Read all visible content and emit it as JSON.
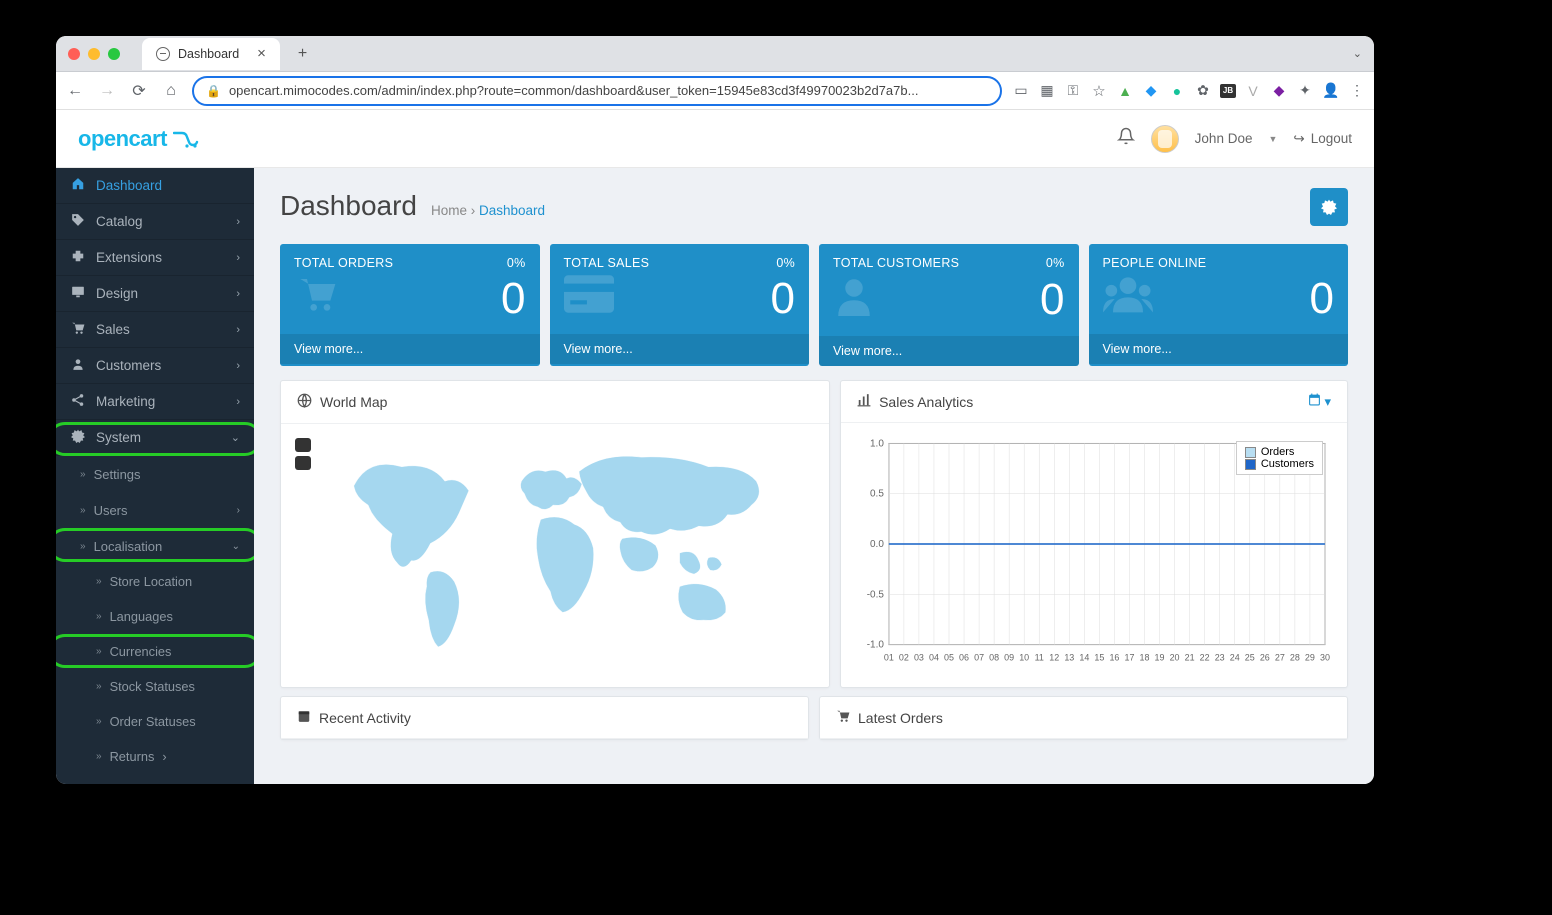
{
  "browser": {
    "tab_title": "Dashboard",
    "url": "opencart.mimocodes.com/admin/index.php?route=common/dashboard&user_token=15945e83cd3f49970023b2d7a7b..."
  },
  "header": {
    "brand": "opencart",
    "user": "John Doe",
    "logout": "Logout"
  },
  "sidebar": {
    "dashboard": "Dashboard",
    "catalog": "Catalog",
    "extensions": "Extensions",
    "design": "Design",
    "sales": "Sales",
    "customers": "Customers",
    "marketing": "Marketing",
    "system": "System",
    "system_children": {
      "settings": "Settings",
      "users": "Users",
      "localisation": "Localisation",
      "localisation_children": {
        "store_location": "Store Location",
        "languages": "Languages",
        "currencies": "Currencies",
        "stock_statuses": "Stock Statuses",
        "order_statuses": "Order Statuses",
        "returns": "Returns"
      }
    }
  },
  "page": {
    "title": "Dashboard",
    "breadcrumb_home": "Home",
    "breadcrumb_current": "Dashboard"
  },
  "tiles": [
    {
      "label": "TOTAL ORDERS",
      "pct": "0%",
      "value": "0",
      "more": "View more..."
    },
    {
      "label": "TOTAL SALES",
      "pct": "0%",
      "value": "0",
      "more": "View more..."
    },
    {
      "label": "TOTAL CUSTOMERS",
      "pct": "0%",
      "value": "0",
      "more": "View more..."
    },
    {
      "label": "PEOPLE ONLINE",
      "pct": "",
      "value": "0",
      "more": "View more..."
    }
  ],
  "panels": {
    "map_title": "World Map",
    "analytics_title": "Sales Analytics",
    "recent_title": "Recent Activity",
    "latest_title": "Latest Orders"
  },
  "chart_data": {
    "type": "line",
    "title": "Sales Analytics",
    "xlabel": "",
    "ylabel": "",
    "ylim": [
      -1.0,
      1.0
    ],
    "yticks": [
      -1.0,
      -0.5,
      0.0,
      0.5,
      1.0
    ],
    "categories": [
      "01",
      "02",
      "03",
      "04",
      "05",
      "06",
      "07",
      "08",
      "09",
      "10",
      "11",
      "12",
      "13",
      "14",
      "15",
      "16",
      "17",
      "18",
      "19",
      "20",
      "21",
      "22",
      "23",
      "24",
      "25",
      "26",
      "27",
      "28",
      "29",
      "30"
    ],
    "series": [
      {
        "name": "Orders",
        "color": "#b8def2",
        "values": [
          0,
          0,
          0,
          0,
          0,
          0,
          0,
          0,
          0,
          0,
          0,
          0,
          0,
          0,
          0,
          0,
          0,
          0,
          0,
          0,
          0,
          0,
          0,
          0,
          0,
          0,
          0,
          0,
          0,
          0
        ]
      },
      {
        "name": "Customers",
        "color": "#1f66c8",
        "values": [
          0,
          0,
          0,
          0,
          0,
          0,
          0,
          0,
          0,
          0,
          0,
          0,
          0,
          0,
          0,
          0,
          0,
          0,
          0,
          0,
          0,
          0,
          0,
          0,
          0,
          0,
          0,
          0,
          0,
          0
        ]
      }
    ]
  }
}
